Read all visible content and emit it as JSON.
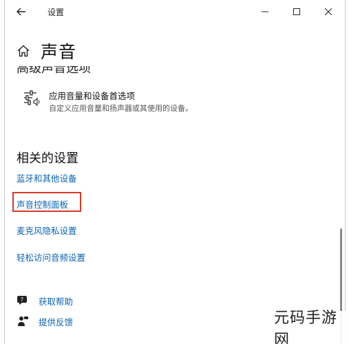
{
  "window": {
    "title": "设置",
    "back_icon": "back-arrow-icon",
    "minimize_icon": "minimize-icon",
    "maximize_icon": "maximize-icon",
    "close_icon": "close-icon"
  },
  "header": {
    "home_icon": "home-icon",
    "title": "声音"
  },
  "advanced": {
    "heading_partial": "高级声音选项",
    "item": {
      "icon": "sliders-speaker-icon",
      "title": "应用音量和设备首选项",
      "description": "自定义应用音量和扬声器或其使用的设备。"
    }
  },
  "related": {
    "heading": "相关的设置",
    "links": [
      "蓝牙和其他设备",
      "声音控制面板",
      "麦克风隐私设置",
      "轻松访问音频设置"
    ],
    "highlighted_index": 1,
    "highlight_color": "#d9372c"
  },
  "help": {
    "get_help": "获取帮助",
    "feedback": "提供反馈"
  },
  "watermark": "元码手游网",
  "colors": {
    "link": "#0a64b4",
    "text": "#111111",
    "muted": "#555555"
  }
}
